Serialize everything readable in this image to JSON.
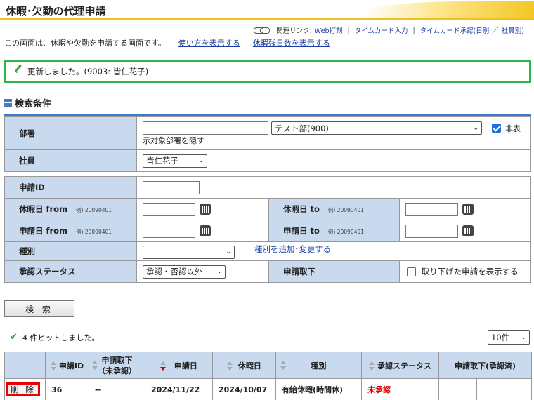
{
  "page": {
    "title": "休暇･欠勤の代理申請",
    "intro_text": "この画面は、休暇や欠勤を申請する画面です。",
    "link_usage": "使い方を表示する",
    "link_remaining": "休暇残日数を表示する"
  },
  "related": {
    "label": "関連リンク:",
    "links": [
      "Web打刻",
      "タイムカード入力",
      "タイムカード承認(日別",
      "社員別)"
    ],
    "slash": "／"
  },
  "message": {
    "text": "更新しました。(9003: 皆仁花子)"
  },
  "search_conditions": {
    "heading": "検索条件",
    "dept_label": "部署",
    "dept_text_value": "",
    "dept_select_value": "テスト部(900)",
    "hide_non_target_label": "非表示対象部署を隠す",
    "hide_non_target_label_a": "非表",
    "hide_non_target_label_b": "示対象部署を隠す",
    "hide_non_target_checked": true,
    "employee_label": "社員",
    "employee_value": "皆仁花子",
    "request_id_label": "申請ID",
    "request_id_value": "",
    "leave_from_label": "休暇日 from",
    "leave_from_example": "例) 20090401",
    "leave_to_label": "休暇日 to",
    "leave_to_example": "例) 20090401",
    "apply_from_label": "申請日 from",
    "apply_from_example": "例) 20090401",
    "apply_to_label": "申請日 to",
    "apply_to_example": "例) 20090401",
    "type_label": "種別",
    "type_value": "",
    "type_link": "種別を追加･変更する",
    "status_label": "承認ステータス",
    "status_value": "承認・否認以外",
    "withdraw_label": "申請取下",
    "withdraw_option": "取り下げた申請を表示する",
    "withdraw_checked": false,
    "search_button": "検 索"
  },
  "results": {
    "hit_text": "4 件ヒットしました。",
    "per_page": "10件",
    "columns": [
      "",
      "申請ID",
      "申請取下\n（未承認）",
      "申請日",
      "休暇日",
      "種別",
      "承認ステータス",
      "申請取下(承認済)"
    ],
    "col_request_id": "申請ID",
    "col_withdraw_pending_a": "申請取下",
    "col_withdraw_pending_b": "（未承認）",
    "col_apply_date": "申請日",
    "col_leave_date": "休暇日",
    "col_type": "種別",
    "col_status": "承認ステータス",
    "col_withdraw_approved": "申請取下(承認済)",
    "rows": [
      {
        "delete_label": "削 除",
        "request_id": "36",
        "withdraw_pending": "--",
        "apply_date": "2024/11/22",
        "leave_date": "2024/10/07",
        "type": "有給休暇(時間休)",
        "status": "未承認",
        "withdraw_approved": ""
      }
    ]
  },
  "colors": {
    "accent_yellow": "#f0c020",
    "success_green": "#2fb34a",
    "label_blue": "#c9d9ee",
    "rule_blue": "#3f79cf",
    "status_red": "#d00000"
  }
}
